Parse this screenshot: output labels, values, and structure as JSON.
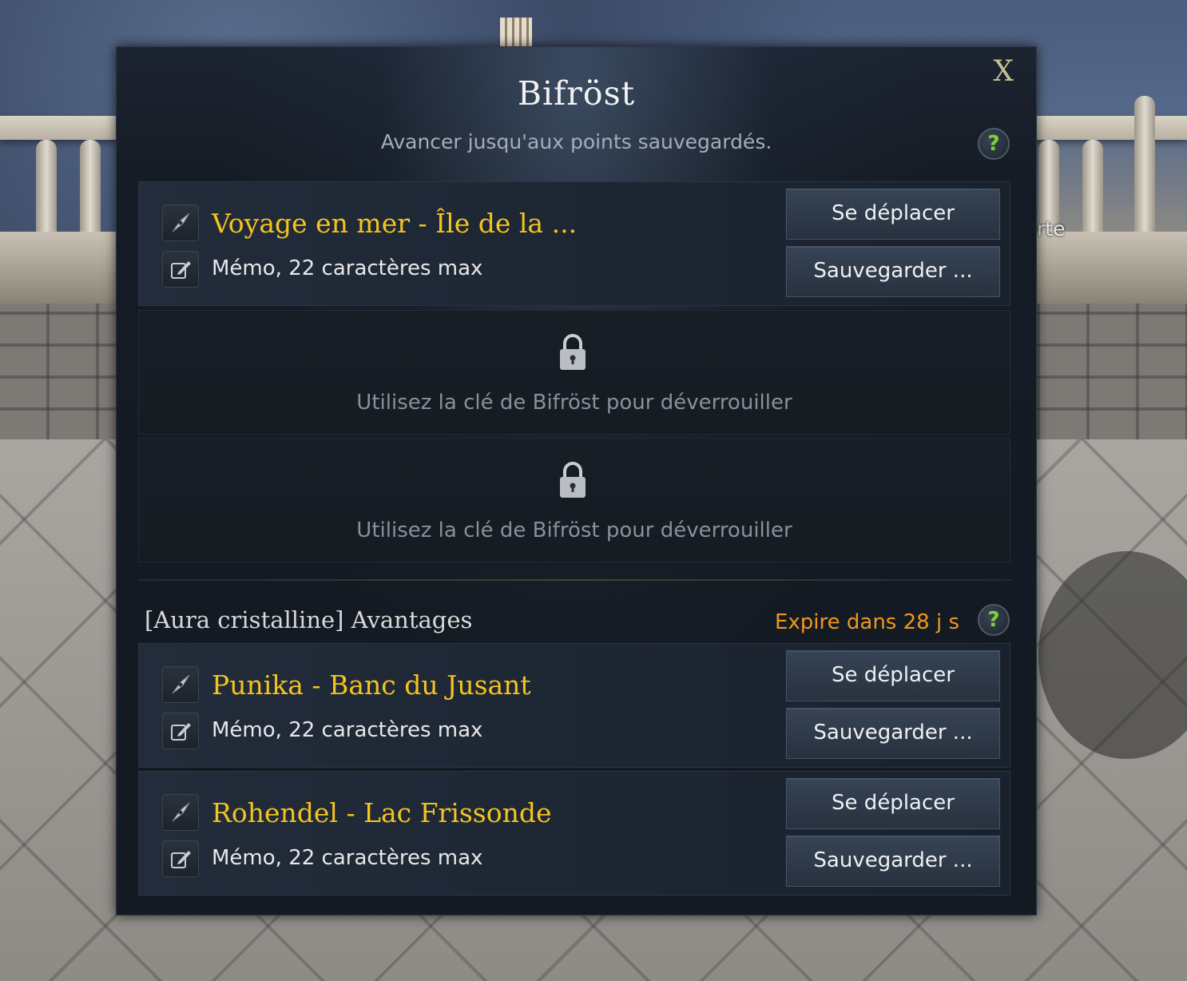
{
  "dialog": {
    "title": "Bifröst",
    "subtitle": "Avancer jusqu'aux points sauvegardés.",
    "close_label": "X",
    "help_label": "?"
  },
  "background": {
    "partial_text": "rte"
  },
  "slots": [
    {
      "name": "Voyage en mer - Île de la ...",
      "memo": "Mémo, 22 caractères max",
      "move_label": "Se déplacer",
      "save_label": "Sauvegarder ..."
    }
  ],
  "locked_slots": [
    {
      "text": "Utilisez la clé de Bifröst pour déverrouiller"
    },
    {
      "text": "Utilisez la clé de Bifröst pour déverrouiller"
    }
  ],
  "aura_section": {
    "title": "[Aura cristalline] Avantages",
    "expire": "Expire dans 28 j s",
    "help_label": "?",
    "slots": [
      {
        "name": "Punika - Banc du Jusant",
        "memo": "Mémo, 22 caractères max",
        "move_label": "Se déplacer",
        "save_label": "Sauvegarder ..."
      },
      {
        "name": "Rohendel - Lac Frissonde",
        "memo": "Mémo, 22 caractères max",
        "move_label": "Se déplacer",
        "save_label": "Sauvegarder ..."
      }
    ]
  },
  "colors": {
    "location_name": "#f5c320",
    "expire_text": "#f0961e",
    "help_icon": "#7dd33a",
    "close_icon": "#c9bd94"
  },
  "icons": {
    "location": "compass-icon",
    "memo": "edit-memo-icon",
    "locked": "padlock-icon"
  }
}
